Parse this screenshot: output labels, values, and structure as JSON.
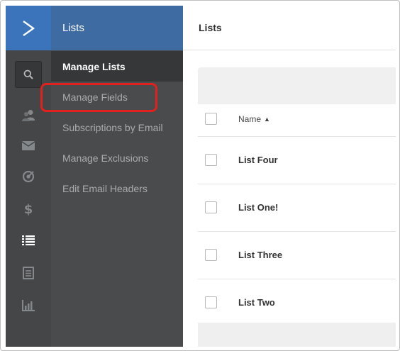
{
  "app": {
    "logo_icon": "chevron-right-icon",
    "accent": "#3b74ba"
  },
  "rail": {
    "search_icon": "search-icon",
    "icons": [
      "contacts-icon",
      "campaigns-icon",
      "automations-icon",
      "deals-icon",
      "lists-icon",
      "forms-icon",
      "reports-icon"
    ]
  },
  "subnav": {
    "title": "Lists",
    "items": [
      {
        "label": "Manage Lists",
        "active": true
      },
      {
        "label": "Manage Fields",
        "active": false
      },
      {
        "label": "Subscriptions by Email",
        "active": false
      },
      {
        "label": "Manage Exclusions",
        "active": false
      },
      {
        "label": "Edit Email Headers",
        "active": false
      }
    ]
  },
  "main": {
    "title": "Lists",
    "table": {
      "header": {
        "name": "Name",
        "sort": "▲"
      },
      "rows": [
        {
          "name": "List Four"
        },
        {
          "name": "List One!"
        },
        {
          "name": "List Three"
        },
        {
          "name": "List Two"
        }
      ]
    }
  },
  "annotation": {
    "highlight_color": "#e0211d"
  }
}
